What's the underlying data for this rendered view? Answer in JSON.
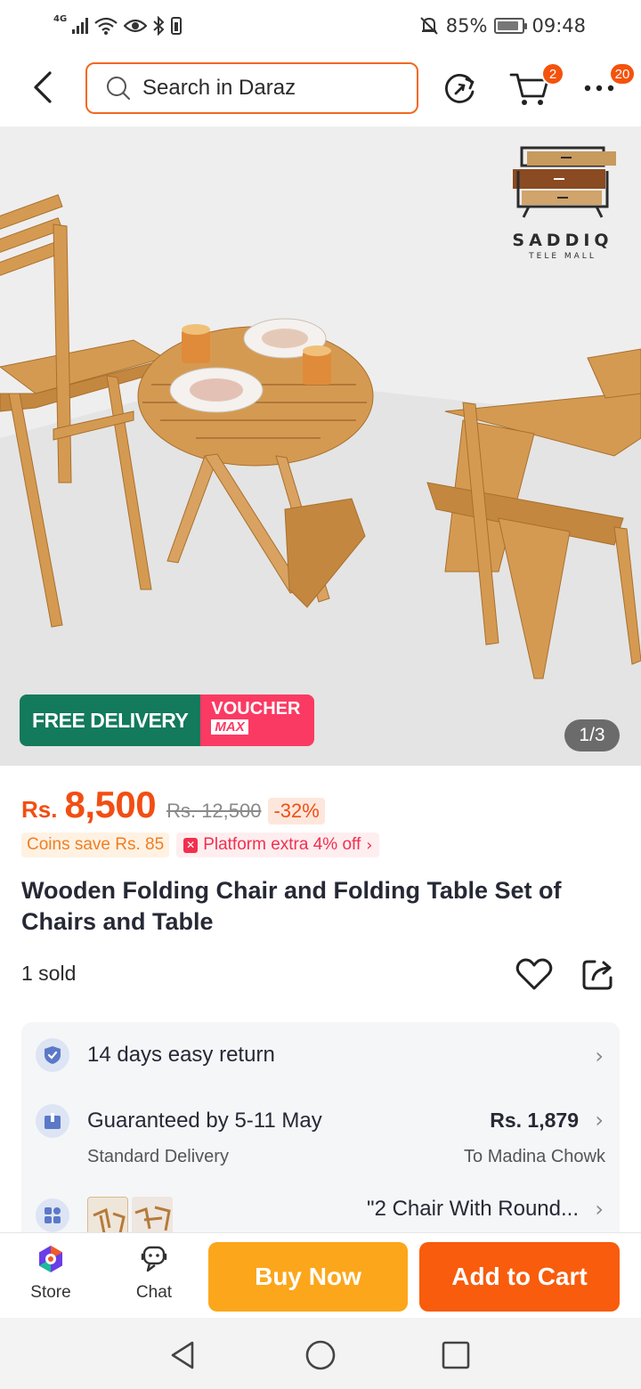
{
  "status_bar": {
    "network": "4G",
    "battery_percent": "85%",
    "time": "09:48",
    "battery_level": 0.85
  },
  "header": {
    "search_placeholder": "Search in Daraz",
    "cart_badge": "2",
    "more_badge": "20"
  },
  "hero": {
    "logo_name": "SADDIQ",
    "logo_sub": "TELE MALL",
    "promo_free_delivery": "FREE DELIVERY",
    "promo_voucher": "VOUCHER",
    "promo_max": "MAX",
    "image_counter": "1/3"
  },
  "product": {
    "currency": "Rs.",
    "price": "8,500",
    "original_price": "Rs. 12,500",
    "discount": "-32%",
    "coins_save": "Coins save Rs. 85",
    "platform_offer": "Platform extra 4% off",
    "title": "Wooden Folding Chair and Folding Table Set of Chairs and Table",
    "sold": "1 sold"
  },
  "services": {
    "return": "14 days easy return",
    "delivery_guarantee": "Guaranteed by 5-11 May",
    "delivery_fee": "Rs. 1,879",
    "delivery_type": "Standard Delivery",
    "delivery_location": "To Madina Chowk",
    "variant_label": "\"2 Chair With Round..."
  },
  "bottom_bar": {
    "store_label": "Store",
    "chat_label": "Chat",
    "buy_now_label": "Buy Now",
    "add_to_cart_label": "Add to Cart"
  },
  "colors": {
    "brand_orange": "#f26822",
    "price_orange": "#f24e13",
    "buy_now": "#fca61b",
    "add_to_cart": "#f85c0c",
    "free_delivery_green": "#137a5c",
    "voucher_pink": "#fb3a63"
  }
}
